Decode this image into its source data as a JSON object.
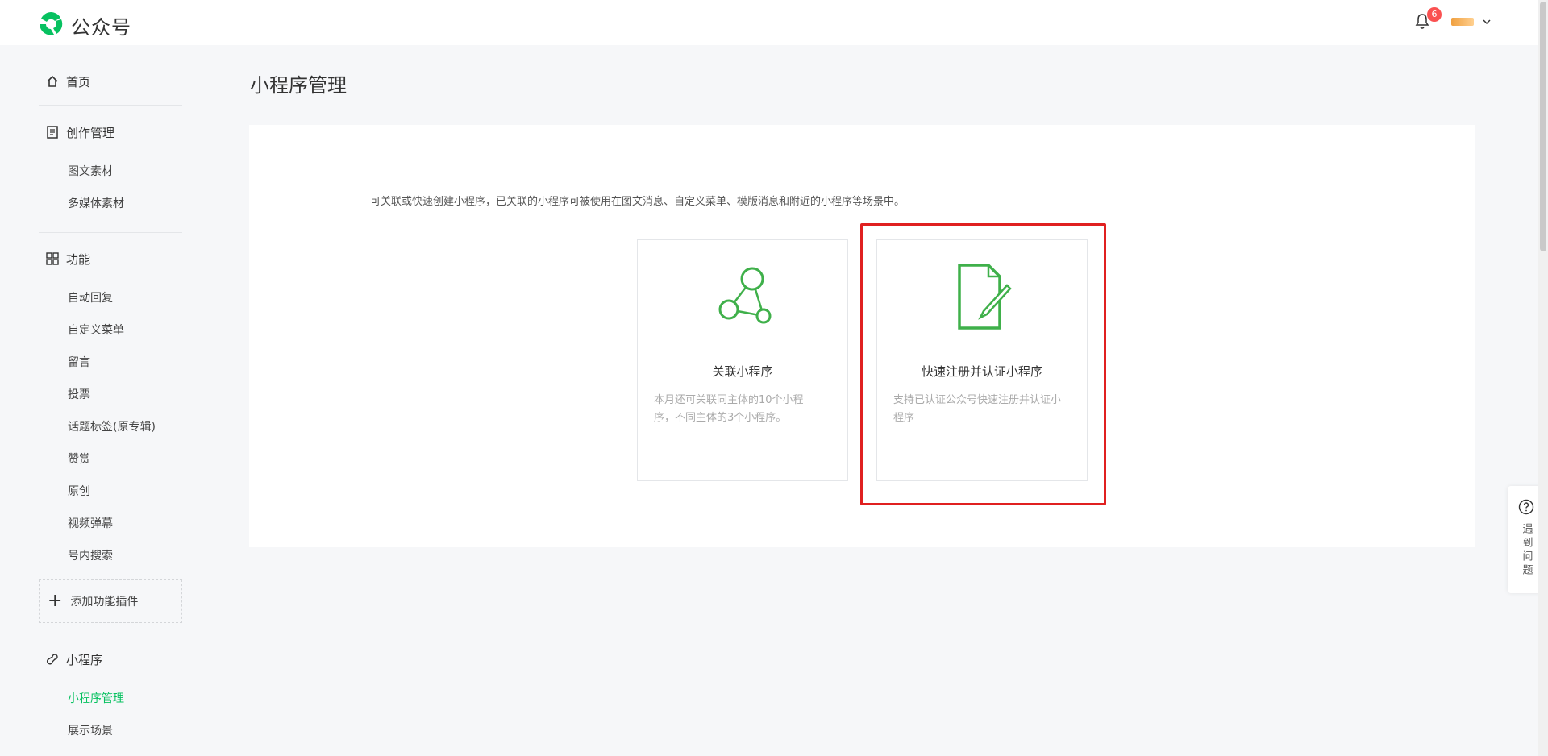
{
  "app": {
    "title": "公众号",
    "notification_count": "6"
  },
  "sidebar": {
    "home": "首页",
    "creation": {
      "label": "创作管理",
      "items": [
        "图文素材",
        "多媒体素材"
      ]
    },
    "features": {
      "label": "功能",
      "items": [
        "自动回复",
        "自定义菜单",
        "留言",
        "投票",
        "话题标签(原专辑)",
        "赞赏",
        "原创",
        "视频弹幕",
        "号内搜索"
      ]
    },
    "add_plugin": "添加功能插件",
    "miniprogram": {
      "label": "小程序",
      "items": [
        "小程序管理",
        "展示场景"
      ],
      "active_item": "小程序管理"
    }
  },
  "main": {
    "title": "小程序管理",
    "description": "可关联或快速创建小程序，已关联的小程序可被使用在图文消息、自定义菜单、模版消息和附近的小程序等场景中。",
    "cards": [
      {
        "icon": "link-nodes-icon",
        "title": "关联小程序",
        "description": "本月还可关联同主体的10个小程序，不同主体的3个小程序。"
      },
      {
        "icon": "document-edit-icon",
        "title": "快速注册并认证小程序",
        "description": "支持已认证公众号快速注册并认证小程序"
      }
    ]
  },
  "help": {
    "label": "遇到问题",
    "icon": "question-icon"
  },
  "colors": {
    "brand_green": "#07c160",
    "icon_green": "#3fb04a",
    "highlight_red": "#e02020",
    "badge_red": "#fa5151"
  }
}
